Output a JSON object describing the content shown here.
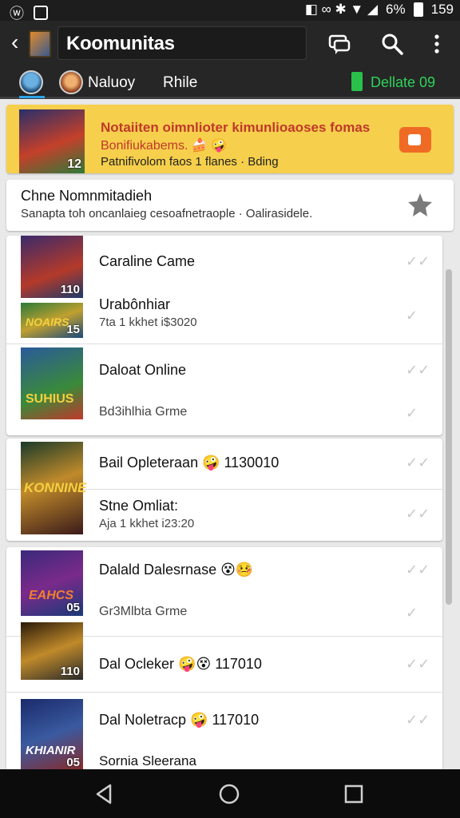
{
  "status_bar": {
    "battery": "6%",
    "time": "159",
    "icons": [
      "app-icon-left",
      "image-icon",
      "signal-icons",
      "wifi-icon",
      "battery-icon"
    ]
  },
  "app_bar": {
    "title": "Koomunitas",
    "actions": [
      "chat-icon",
      "search-icon",
      "more-vert-icon"
    ]
  },
  "tabs": {
    "items": [
      {
        "label": "Naluoy"
      },
      {
        "label": "Rhile"
      }
    ],
    "status_label": "Dellate 09"
  },
  "promo": {
    "line1": "Notaiiten oimnlioter kimunlioaoses fomas",
    "line2": "Bonifiukabems. 🍰 🤪",
    "line3": "Patnifivolom faos 1 flanes · Bding",
    "thumb_number": "12"
  },
  "notice": {
    "title": "Chne Nomnmitadieh",
    "subtitle": "Sanapta toh oncanlaieg cesoafnetraople · Oalirasidele."
  },
  "cards": [
    {
      "rows": [
        {
          "title": "Caraline Came",
          "sub": "",
          "thumb_number": "110"
        },
        {
          "title": "Urabônhiar",
          "sub": "7ta 1 kkhet i$3020",
          "thumb_number": "15"
        },
        {
          "title": "Daloat Online",
          "sub": "",
          "thumb_number": ""
        },
        {
          "title": "Bd3ihlhia Grme",
          "sub": "",
          "thumb_number": ""
        }
      ]
    },
    {
      "rows": [
        {
          "title": "Bail Opleteraan 🤪 1130010",
          "sub": "",
          "thumb_number": ""
        },
        {
          "title": "Stne Omliat:",
          "sub": "Aja 1 kkhet i23:20",
          "thumb_number": ""
        }
      ]
    },
    {
      "rows": [
        {
          "title": "Dalald Dalesrnase 😵🤒",
          "sub": "",
          "thumb_number": "05"
        },
        {
          "title": "Gr3Mlbta Grme",
          "sub": "",
          "thumb_number": ""
        },
        {
          "title": "Dal Ocleker 🤪😵 117010",
          "sub": "",
          "thumb_number": "110"
        },
        {
          "title": "Dal Noletracp 🤪 117010",
          "sub": "",
          "thumb_number": ""
        },
        {
          "title": "Sornia Sleerana",
          "sub": "",
          "thumb_number": "05"
        }
      ]
    }
  ],
  "thumb_texts": [
    "NOAIRS",
    "SUHIUS",
    "KONNINE",
    "EAHCS",
    "KHIANIR"
  ],
  "navbar": {
    "buttons": [
      "back-icon",
      "home-icon",
      "recent-apps-icon"
    ]
  },
  "colors": {
    "appbar": "#262626",
    "promo_bg": "#f6cf4c",
    "promo_red": "#c0392b",
    "accent_green": "#2fd25a",
    "tab_indicator": "#2aa3e8"
  }
}
